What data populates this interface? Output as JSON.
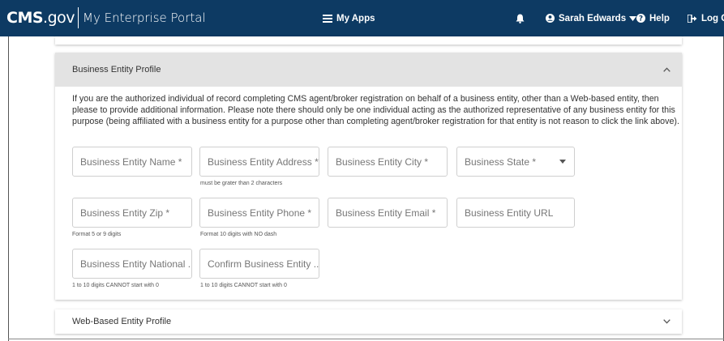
{
  "header": {
    "brand_cms": "CMS",
    "brand_gov": ".gov",
    "portal_title": "My Enterprise Portal",
    "my_apps_label": "My Apps",
    "user_name": "Sarah Edwards",
    "help_label": "Help",
    "logout_label": "Log Ou"
  },
  "business_section": {
    "title": "Business Entity Profile",
    "description": "If you are the authorized individual of record completing CMS agent/broker registration on behalf of a business entity, other than a Web-based entity, then please to provide additional information. Please note there should only be one individual acting as the authorized representative of any business entity for this purpose (being affiliated with a business entity for a purpose other than completing agent/broker registration for that entity is not reason to click the link above).",
    "fields": {
      "name_placeholder": "Business Entity Name *",
      "address_placeholder": "Business Entity Address *",
      "address_hint": "must be grater than 2 characters",
      "city_placeholder": "Business Entity City *",
      "state_placeholder": "Business State *",
      "zip_placeholder": "Business Entity Zip *",
      "zip_hint": "Format 5 or 9 digits",
      "phone_placeholder": "Business Entity Phone *",
      "phone_hint": "Format 10 digits with NO dash",
      "email_placeholder": "Business Entity Email *",
      "url_placeholder": "Business Entity URL",
      "national_placeholder": "Business Entity National ...",
      "national_hint": "1 to 10 digits CANNOT start with 0",
      "confirm_placeholder": "Confirm Business Entity ...",
      "confirm_hint": "1 to 10 digits CANNOT start with 0"
    }
  },
  "web_section": {
    "title": "Web-Based Entity Profile"
  },
  "colors": {
    "header_bg": "#0d3a63",
    "section_header_bg": "#e3e3e3"
  }
}
